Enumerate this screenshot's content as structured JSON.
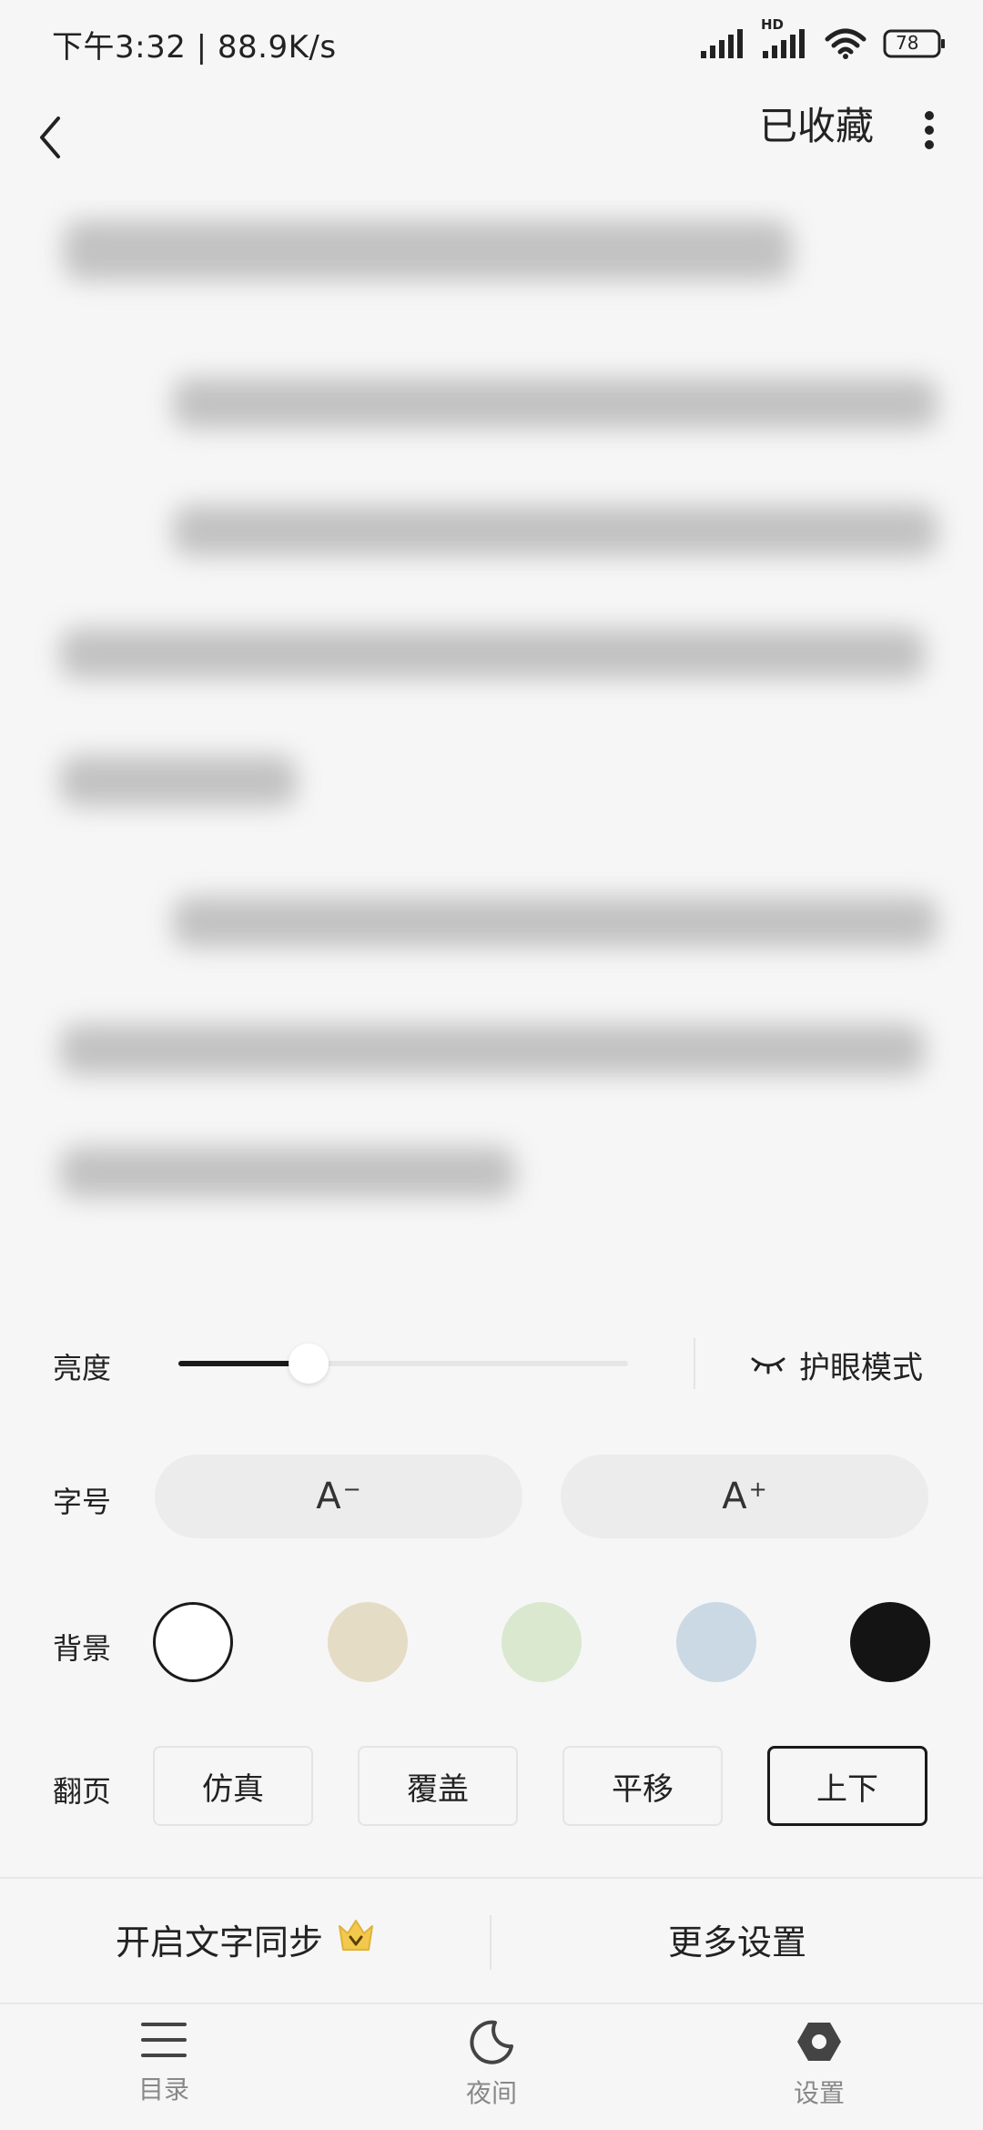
{
  "status_bar": {
    "time_speed": "下午3:32 | 88.9K/s",
    "network_label": "HD",
    "battery": "78"
  },
  "top_bar": {
    "favorite_label": "已收藏"
  },
  "settings": {
    "brightness": {
      "label": "亮度",
      "level": 0.29
    },
    "eye_mode_label": "护眼模式",
    "font_size": {
      "label": "字号",
      "decrease": "A",
      "increase": "A"
    },
    "background": {
      "label": "背景",
      "colors": [
        "#ffffff",
        "#e5dcc6",
        "#d9e8cf",
        "#cbd9e4",
        "#141414"
      ],
      "selected_index": 0
    },
    "page_flip": {
      "label": "翻页",
      "options": [
        "仿真",
        "覆盖",
        "平移",
        "上下"
      ],
      "selected_index": 3
    }
  },
  "actions": {
    "text_sync": "开启文字同步",
    "more_settings": "更多设置"
  },
  "tabs": [
    {
      "label": "目录",
      "icon": "menu-icon"
    },
    {
      "label": "夜间",
      "icon": "moon-icon"
    },
    {
      "label": "设置",
      "icon": "settings-icon"
    }
  ],
  "colors": {
    "accent": "#1a1a1a",
    "crown": "#f2c94c"
  }
}
